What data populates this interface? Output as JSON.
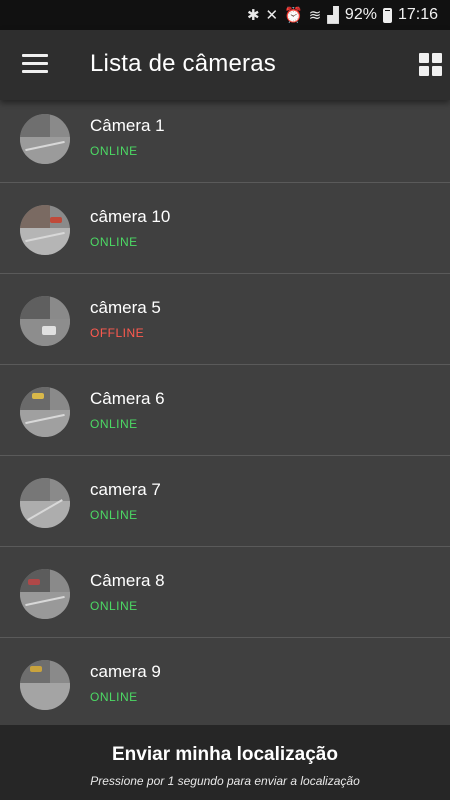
{
  "status_bar": {
    "icons": [
      "bluetooth-icon",
      "mute-icon",
      "alarm-icon",
      "wifi-icon",
      "signal-icon"
    ],
    "battery": "92%",
    "time": "17:16"
  },
  "app_bar": {
    "title": "Lista de câmeras",
    "menu_icon": "hamburger-menu-icon",
    "grid_icon": "grid-view-icon"
  },
  "colors": {
    "online": "#4cd964",
    "offline": "#ff5a4f",
    "list_bg": "#404040",
    "app_bar_bg": "#2e2e2e",
    "footer_bg": "#262626"
  },
  "cameras": [
    {
      "name": "Câmera 1",
      "status": "ONLINE"
    },
    {
      "name": "câmera 10",
      "status": "ONLINE"
    },
    {
      "name": "câmera 5",
      "status": "OFFLINE"
    },
    {
      "name": "Câmera 6",
      "status": "ONLINE"
    },
    {
      "name": "camera 7",
      "status": "ONLINE"
    },
    {
      "name": "Câmera 8",
      "status": "ONLINE"
    },
    {
      "name": "camera 9",
      "status": "ONLINE"
    }
  ],
  "footer": {
    "title": "Enviar minha localização",
    "subtitle": "Pressione por 1 segundo para enviar a localização"
  }
}
